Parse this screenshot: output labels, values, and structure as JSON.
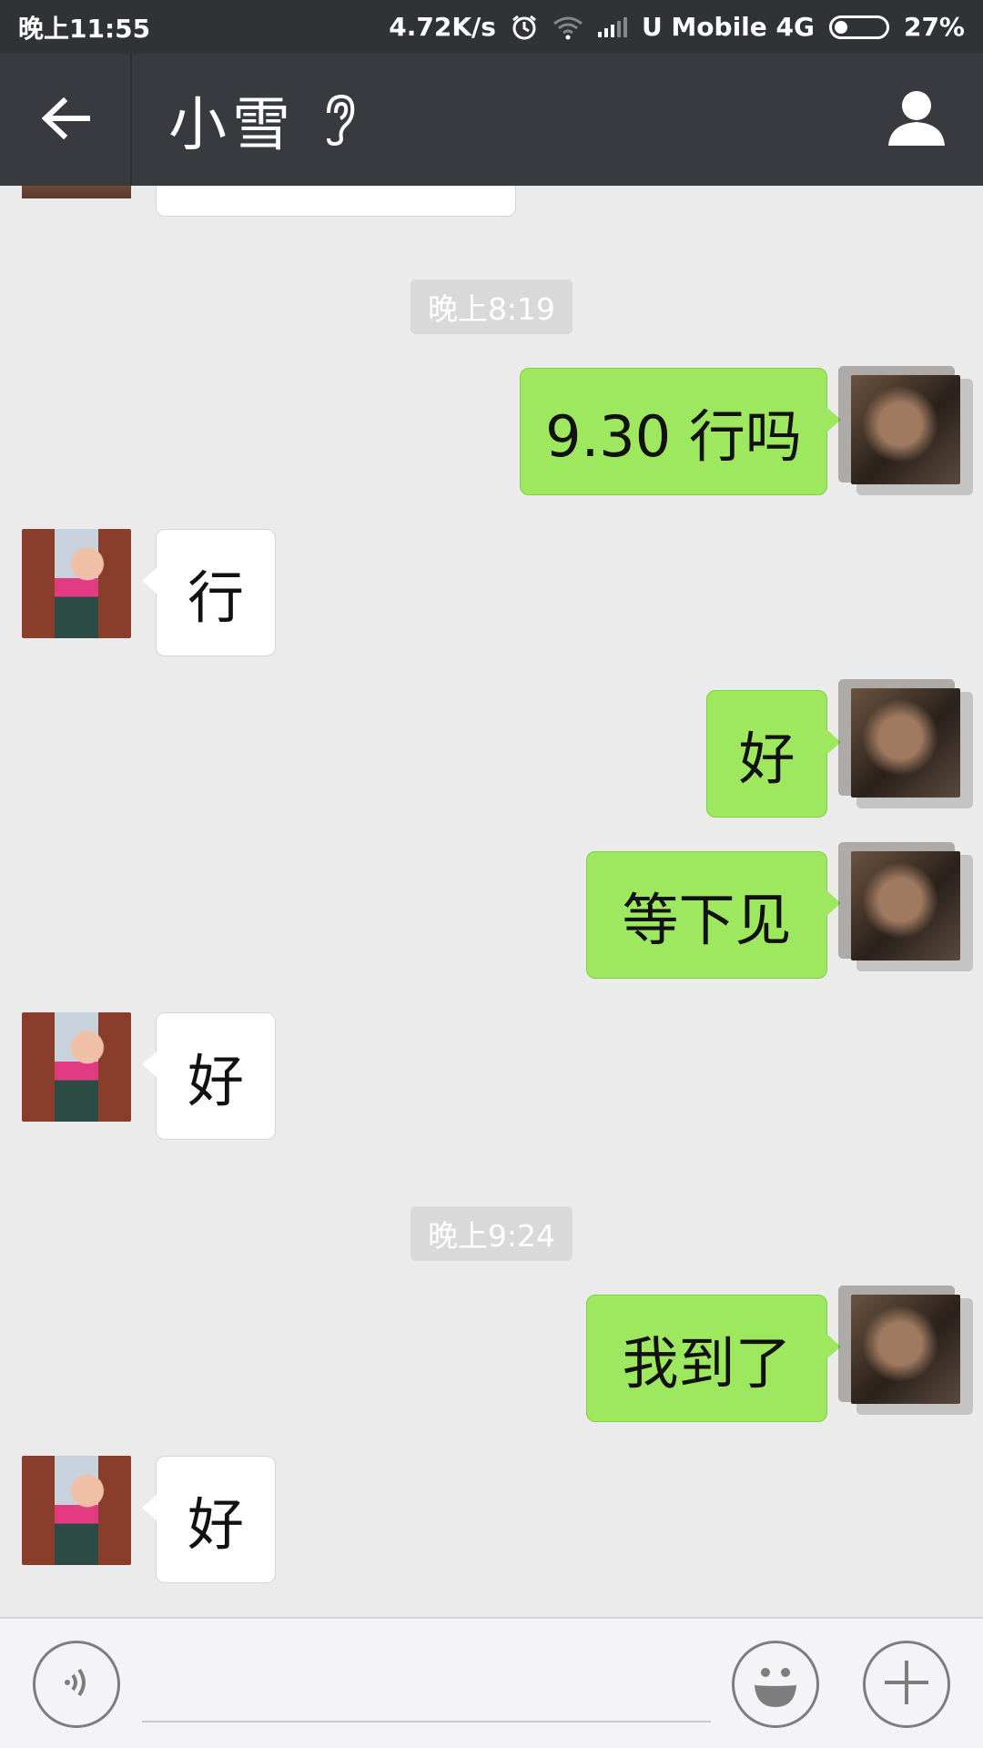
{
  "status_bar": {
    "time": "晚上11:55",
    "speed": "4.72K/s",
    "carrier": "U Mobile 4G",
    "battery": "27%"
  },
  "header": {
    "title": "小雪",
    "back_icon": "back-arrow-icon",
    "mode_icon": "ear-icon",
    "profile_icon": "profile-icon"
  },
  "timestamps": [
    "晚上8:19",
    "晚上9:24"
  ],
  "messages": [
    {
      "side": "right",
      "text": "9.30 行吗"
    },
    {
      "side": "left",
      "text": "行"
    },
    {
      "side": "right",
      "text": "好"
    },
    {
      "side": "right",
      "text": "等下见"
    },
    {
      "side": "left",
      "text": "好"
    },
    {
      "side": "right",
      "text": "我到了"
    },
    {
      "side": "left",
      "text": "好"
    }
  ],
  "input": {
    "value": "",
    "voice_icon": "voice-icon",
    "emoji_icon": "emoji-icon",
    "plus_icon": "plus-icon"
  },
  "colors": {
    "status_bar": "#303336",
    "title_bar": "#393a3f",
    "chat_bg": "#ebebeb",
    "sent_bubble": "#9ee85f",
    "received_bubble": "#ffffff"
  }
}
